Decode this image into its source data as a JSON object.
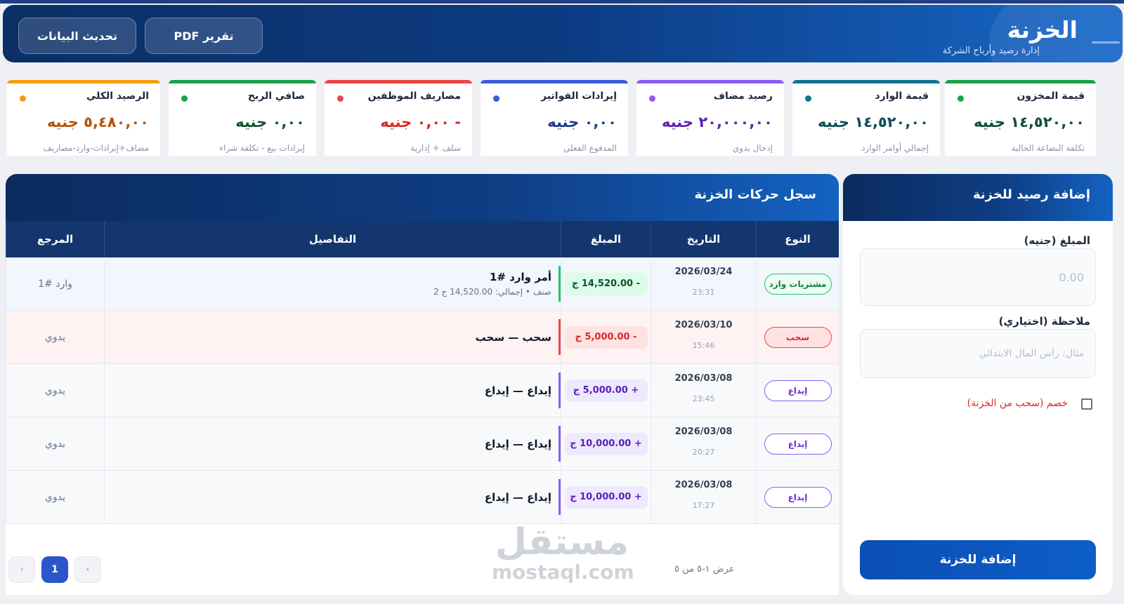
{
  "header": {
    "title": "الخزنة",
    "subtitle": "إدارة رصيد وأرباح الشركة",
    "refresh_button": "تحديث البيانات",
    "pdf_button": "تقرير PDF"
  },
  "cards": [
    {
      "title": "قيمة المخزون",
      "value": "١٤,٥٢٠,٠٠ جنيه",
      "sub": "تكلفة البضاعة الحالية",
      "bar_color": "#16a34a",
      "dot_color": "#16a34a",
      "value_color": "#0f5132"
    },
    {
      "title": "قيمة الوارد",
      "value": "١٤,٥٢٠,٠٠ جنيه",
      "sub": "إجمالي أوامر الوارد",
      "bar_color": "#0e7490",
      "dot_color": "#0e7490",
      "value_color": "#0f4c5c"
    },
    {
      "title": "رصيد مضاف",
      "value": "٢٠,٠٠٠,٠٠ جنيه",
      "sub": "إدخال يدوي",
      "bar_color": "#8b5cf6",
      "dot_color": "#8b5cf6",
      "value_color": "#5b21b6"
    },
    {
      "title": "إيرادات الفواتير",
      "value": "٠,٠٠ جنيه",
      "sub": "المدفوع الفعلي",
      "bar_color": "#3b5bdb",
      "dot_color": "#3b5bdb",
      "value_color": "#1e3a8a"
    },
    {
      "title": "مصاريف الموظفين",
      "value": "- ٠,٠٠ جنيه",
      "sub": "سلف + إدارية",
      "bar_color": "#ef4444",
      "dot_color": "#ef4444",
      "value_color": "#dc2626"
    },
    {
      "title": "صافي الربح",
      "value": "٠,٠٠ جنيه",
      "sub": "إيرادات بيع - تكلفة شراء",
      "bar_color": "#16a34a",
      "dot_color": "#16a34a",
      "value_color": "#14532d"
    },
    {
      "title": "الرصيد الكلي",
      "value": "٥,٤٨٠,٠٠ جنيه",
      "sub": "مضاف+إيرادات-وارد-مصاريف",
      "bar_color": "#f59e0b",
      "dot_color": "#f59e0b",
      "value_color": "#b45309"
    }
  ],
  "table": {
    "title": "سجل حركات الخزنة",
    "columns": [
      "النوع",
      "التاريخ",
      "المبلغ",
      "التفاصيل",
      "المرجع"
    ],
    "rows": [
      {
        "type": "مشتريات وارد",
        "date": "2026/03/24",
        "time": "23:31",
        "amount": "- 14,520.00 ج",
        "detail": "أمر وارد #1",
        "detail_sub": "صنف  •  إجمالي: 14,520.00 ج 2",
        "ref": "وارد #1"
      },
      {
        "type": "سحب",
        "date": "2026/03/10",
        "time": "15:46",
        "amount": "- 5,000.00 ج",
        "detail": "سحب — سحب",
        "detail_sub": "",
        "ref": "يدوي"
      },
      {
        "type": "إيداع",
        "date": "2026/03/08",
        "time": "23:45",
        "amount": "+ 5,000.00 ج",
        "detail": "إيداع — إيداع",
        "detail_sub": "",
        "ref": "يدوي"
      },
      {
        "type": "إيداع",
        "date": "2026/03/08",
        "time": "20:27",
        "amount": "+ 10,000.00 ج",
        "detail": "إيداع — إيداع",
        "detail_sub": "",
        "ref": "يدوي"
      },
      {
        "type": "إيداع",
        "date": "2026/03/08",
        "time": "17:27",
        "amount": "+ 10,000.00 ج",
        "detail": "إيداع — إيداع",
        "detail_sub": "",
        "ref": "يدوي"
      }
    ],
    "count_text": "عرض ١-٥ من ٥",
    "page": "1",
    "prev_icon": "‹",
    "next_icon": "›"
  },
  "form": {
    "title": "إضافة رصيد للخزنة",
    "amount_label": "المبلغ (جنيه)",
    "amount_placeholder": "0.00",
    "note_label": "ملاحظة (اختياري)",
    "note_placeholder": "مثال: رأس المال الابتدائي",
    "deduct_label": "خصم (سحب من الخزنة)",
    "submit": "إضافة للخزنة"
  },
  "watermark": {
    "line1": "مستقل",
    "line2": "mostaql.com"
  }
}
